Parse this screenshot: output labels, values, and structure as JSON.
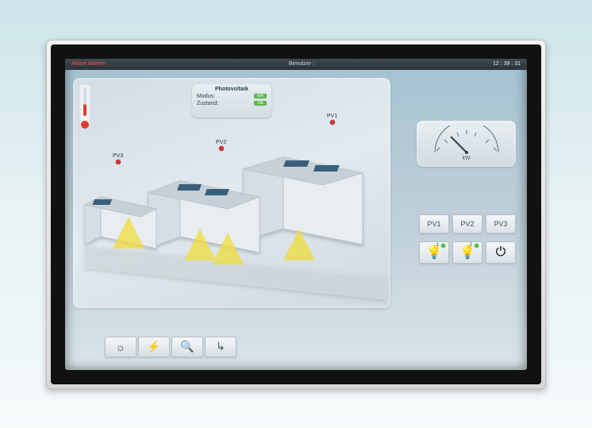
{
  "status": {
    "alarm_label": "Aktive Alarme :",
    "alarm_text": "",
    "user_label": "Benutzer :",
    "user_value": "",
    "clock": "12 : 39 : 31"
  },
  "info_panel": {
    "title": "Photovoltaik",
    "row1_label": "Modus:",
    "row1_value": "ein",
    "row2_label": "Zustand:",
    "row2_value": "Ok"
  },
  "pv_markers": {
    "pv1": "PV1",
    "pv2": "PV2",
    "pv3": "PV3"
  },
  "gauge": {
    "unit": "kW"
  },
  "pv_buttons": {
    "b1": "PV1",
    "b2": "PV2",
    "b3": "PV3"
  },
  "light_buttons": {
    "l1": "1",
    "l2": "2"
  }
}
